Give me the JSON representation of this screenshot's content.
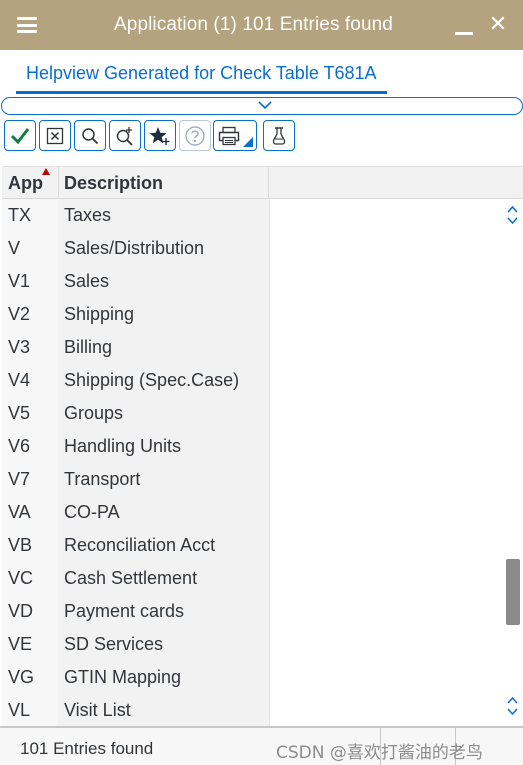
{
  "window": {
    "title": "Application (1)  101 Entries found",
    "menu_icon": "hamburger-icon",
    "minimize_icon": "minimize-icon",
    "close_icon": "close-icon",
    "close_glyph": "✕"
  },
  "tab": {
    "label": "Helpview Generated for Check Table T681A"
  },
  "toolbar": {
    "buttons": [
      {
        "icon": "checkmark-icon"
      },
      {
        "icon": "cancel-icon"
      },
      {
        "icon": "search-icon"
      },
      {
        "icon": "search-more-icon"
      },
      {
        "icon": "personal-list-icon"
      },
      {
        "icon": "help-icon"
      },
      {
        "icon": "print-icon"
      },
      {
        "icon": "dropdown-icon"
      },
      {
        "icon": "technical-info-icon"
      }
    ]
  },
  "table": {
    "columns": [
      {
        "label": "App",
        "sorted": "ascending"
      },
      {
        "label": "Description"
      }
    ],
    "rows": [
      {
        "app": "TX",
        "desc": "Taxes"
      },
      {
        "app": "V",
        "desc": "Sales/Distribution"
      },
      {
        "app": "V1",
        "desc": "Sales"
      },
      {
        "app": "V2",
        "desc": "Shipping"
      },
      {
        "app": "V3",
        "desc": "Billing"
      },
      {
        "app": "V4",
        "desc": "Shipping (Spec.Case)"
      },
      {
        "app": "V5",
        "desc": "Groups"
      },
      {
        "app": "V6",
        "desc": "Handling Units"
      },
      {
        "app": "V7",
        "desc": "Transport"
      },
      {
        "app": "VA",
        "desc": "CO-PA"
      },
      {
        "app": "VB",
        "desc": "Reconciliation Acct"
      },
      {
        "app": "VC",
        "desc": "Cash Settlement"
      },
      {
        "app": "VD",
        "desc": "Payment cards"
      },
      {
        "app": "VE",
        "desc": "SD Services"
      },
      {
        "app": "VG",
        "desc": "GTIN Mapping"
      },
      {
        "app": "VL",
        "desc": "Visit List"
      }
    ]
  },
  "status": {
    "text": "101 Entries found",
    "watermark": "CSDN @喜欢打酱油的老鸟"
  },
  "colors": {
    "titlebar": "#b5a27f",
    "accent": "#0a6ed1",
    "sort_marker": "#bb0000"
  }
}
